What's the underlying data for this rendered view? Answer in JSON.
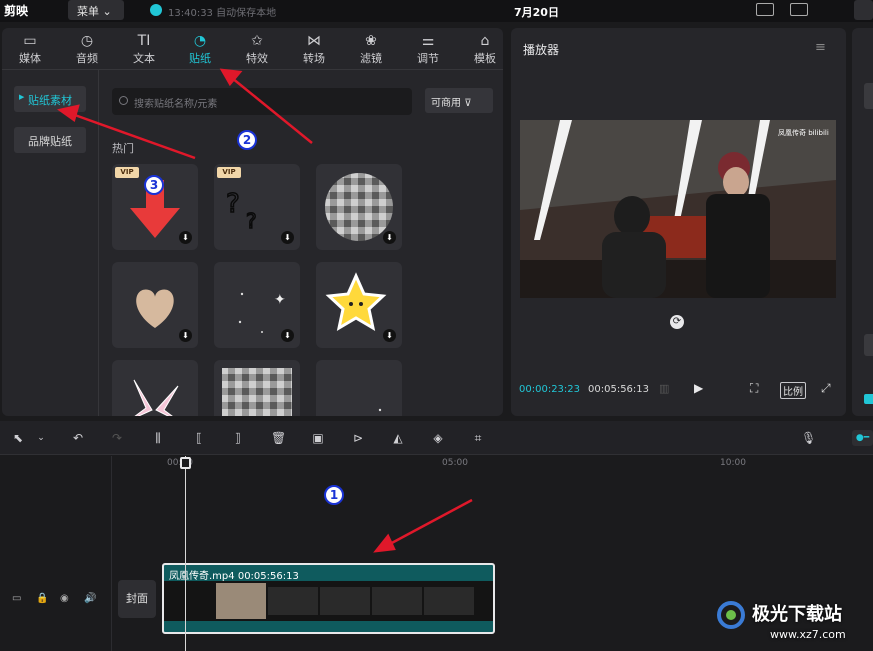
{
  "app": {
    "logo": "剪映",
    "menu_label": "菜单",
    "save_status": "13:40:33 自动保存本地",
    "date": "7月20日"
  },
  "tabs": [
    {
      "label": "媒体",
      "icon": "media-icon"
    },
    {
      "label": "音频",
      "icon": "audio-icon"
    },
    {
      "label": "文本",
      "icon": "text-icon"
    },
    {
      "label": "贴纸",
      "icon": "sticker-icon"
    },
    {
      "label": "特效",
      "icon": "effects-icon"
    },
    {
      "label": "转场",
      "icon": "transition-icon"
    },
    {
      "label": "滤镜",
      "icon": "filter-icon"
    },
    {
      "label": "调节",
      "icon": "adjust-icon"
    },
    {
      "label": "模板",
      "icon": "template-icon"
    }
  ],
  "sidebar": {
    "items": [
      {
        "label": "贴纸素材"
      },
      {
        "label": "品牌贴纸"
      }
    ]
  },
  "search": {
    "placeholder": "搜索贴纸名称/元素"
  },
  "filter": {
    "label": "可商用"
  },
  "section": {
    "hot": "热门"
  },
  "stickers": {
    "vip_badge": "VIP"
  },
  "player": {
    "title": "播放器",
    "current_time": "00:00:23:23",
    "total_time": "00:05:56:13",
    "ratio_label": "比例",
    "video_watermark": "凤凰传奇 bilibili"
  },
  "timeline": {
    "ticks": [
      "00:00",
      "05:00",
      "10:00"
    ],
    "clip_name": "凤凰传奇.mp4",
    "clip_duration": "00:05:56:13",
    "cover_label": "封面"
  },
  "annotations": [
    "1",
    "2",
    "3"
  ],
  "watermark": {
    "title": "极光下载站",
    "url": "www.xz7.com"
  },
  "colors": {
    "accent": "#21c6d6",
    "annotation_arrow": "#e0182a"
  }
}
